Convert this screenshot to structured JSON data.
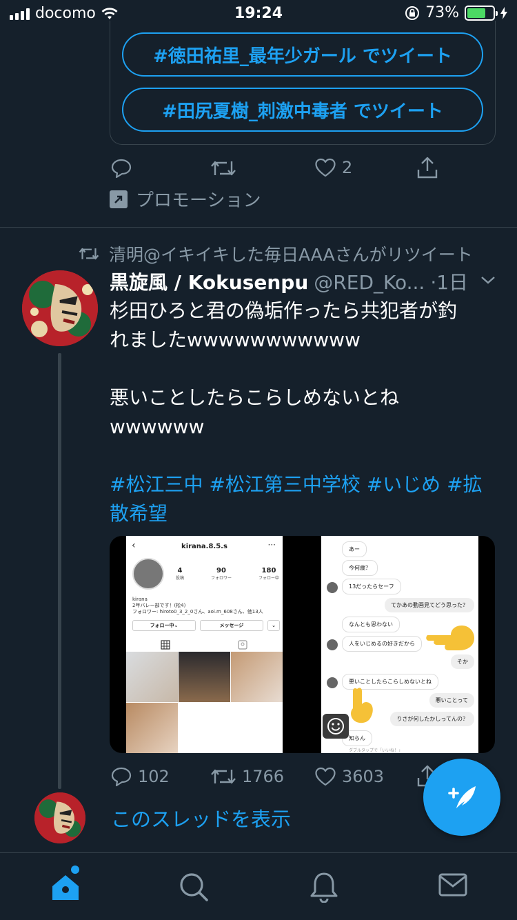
{
  "status_bar": {
    "carrier": "docomo",
    "time": "19:24",
    "battery_percent": "73%",
    "battery_level": 0.73,
    "battery_color": "#4cd964"
  },
  "promo": {
    "hashtag_buttons": [
      "#徳田祐里_最年少ガール でツイート",
      "#田尻夏樹_刺激中毒者 でツイート"
    ],
    "like_count": "2",
    "promoted_label": "プロモーション"
  },
  "tweet": {
    "retweeted_by": "清明@イキイキした毎日AAAさんがリツイート",
    "display_name": "黒旋風 / Kokusenpu",
    "handle": "@RED_Ko...",
    "time": "·1日",
    "text_line1": "杉田ひろと君の偽垢作ったら共犯者が釣",
    "text_line2": "れましたwwwwwwwwwww",
    "text_line3": "悪いことしたらこらしめないとね",
    "text_line4": "wwwwww",
    "hashtags_line1": "#松江三中 #松江第三中学校 #いじめ #拡",
    "hashtags_line2": "散希望",
    "reply_count": "102",
    "retweet_count": "1766",
    "like_count": "3603",
    "show_thread": "このスレッドを表示"
  },
  "media": {
    "profile_shot": {
      "username": "kirana.8.5.s",
      "posts": "4",
      "posts_label": "投稿",
      "followers": "90",
      "followers_label": "フォロワー",
      "following": "180",
      "following_label": "フォロー中",
      "bio_name": "kirana",
      "bio_line": "2年バレー部です！(松4)",
      "followed_by": "フォロワー: hiroto0_3_2_0さん、aoi.m_608さん、他13人",
      "follow_button": "フォロー中⌄",
      "message_button": "メッセージ"
    },
    "chat_shot": {
      "messages": [
        "あー",
        "今何歳？",
        "13だったらセーフ",
        "てかあの動画見てどう思った？",
        "なんとも思わない",
        "人をいじめるの好きだから",
        "そか",
        "悪いことしたらこらしめないとね",
        "悪いことって",
        "りさが何したかしってんの？",
        "知らん"
      ],
      "footer": "ダブルタップで「いいね！」"
    }
  },
  "colors": {
    "background": "#15202b",
    "accent": "#1da1f2",
    "muted": "#8899a6",
    "divider": "#38444d"
  },
  "tabbar": {
    "items": [
      "home-icon",
      "search-icon",
      "notifications-icon",
      "messages-icon"
    ]
  }
}
